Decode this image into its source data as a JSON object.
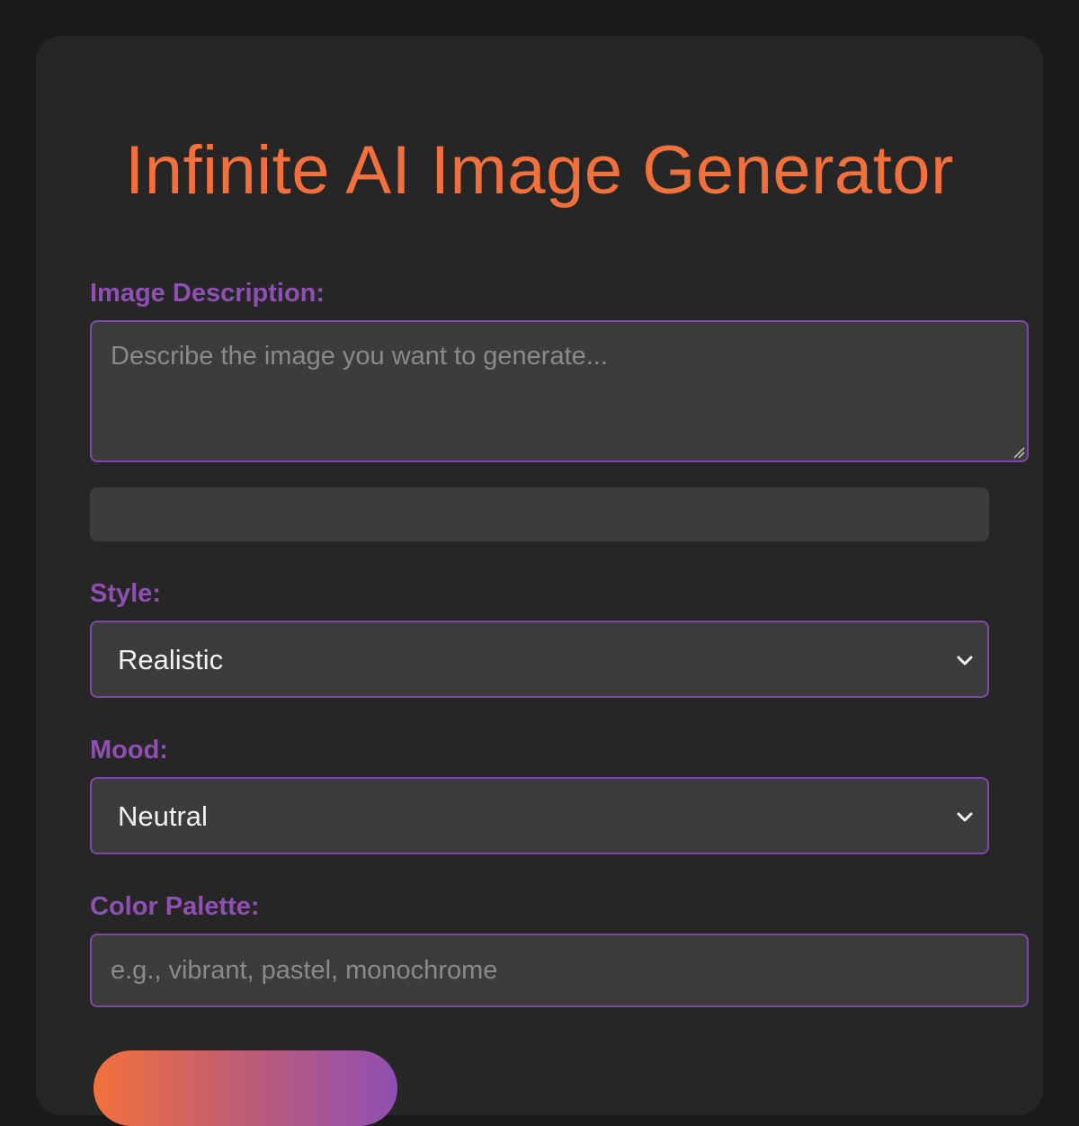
{
  "header": {
    "title": "Infinite AI Image Generator"
  },
  "form": {
    "description": {
      "label": "Image Description:",
      "placeholder": "Describe the image you want to generate...",
      "value": ""
    },
    "style": {
      "label": "Style:",
      "selected": "Realistic"
    },
    "mood": {
      "label": "Mood:",
      "selected": "Neutral"
    },
    "color_palette": {
      "label": "Color Palette:",
      "placeholder": "e.g., vibrant, pastel, monochrome",
      "value": ""
    },
    "generate_label": ""
  },
  "colors": {
    "accent_orange": "#f2703c",
    "accent_purple": "#8f4fb3",
    "page_background": "#1b1b1b",
    "card_background": "#262626",
    "field_background": "#3c3c3c"
  },
  "icons": {
    "select_arrow": "chevron-down-icon",
    "textarea_resize": "resize-handle-icon"
  }
}
